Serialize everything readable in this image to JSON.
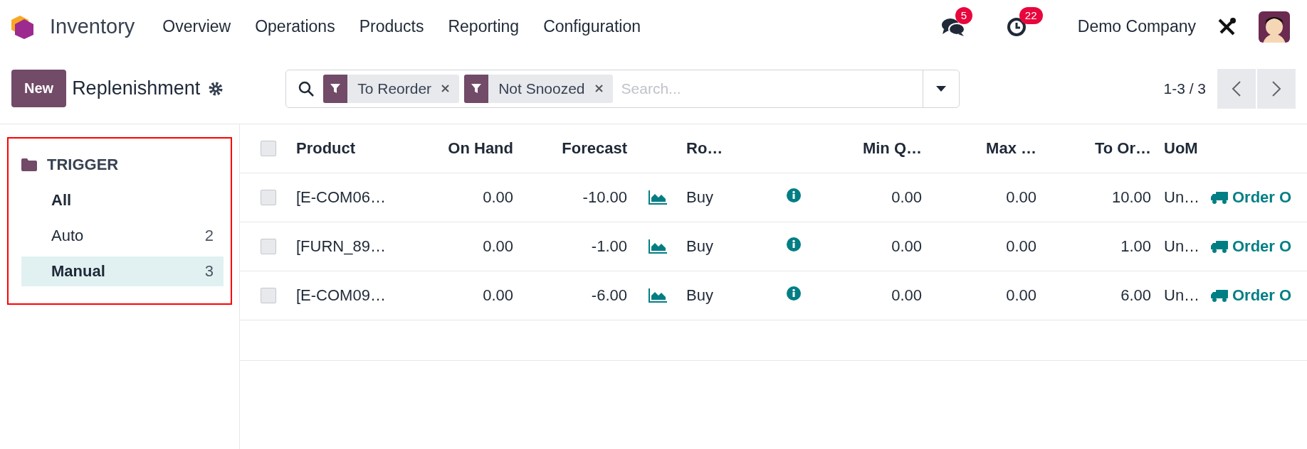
{
  "navbar": {
    "app_name": "Inventory",
    "menu": [
      "Overview",
      "Operations",
      "Products",
      "Reporting",
      "Configuration"
    ],
    "messages_badge": "5",
    "activities_badge": "22",
    "company": "Demo Company"
  },
  "control_panel": {
    "new_button": "New",
    "title": "Replenishment",
    "filters": [
      {
        "label": "To Reorder"
      },
      {
        "label": "Not Snoozed"
      }
    ],
    "search": {
      "placeholder": "Search..."
    },
    "pager": "1-3 / 3"
  },
  "sidebar": {
    "highlighted": true,
    "heading": "TRIGGER",
    "items": [
      {
        "label": "All",
        "selected": false
      },
      {
        "label": "Auto",
        "count": "2",
        "selected": false
      },
      {
        "label": "Manual",
        "count": "3",
        "selected": true
      }
    ]
  },
  "table": {
    "select_all_checked": false,
    "columns": [
      "Product",
      "On Hand",
      "Forecast",
      "Ro…",
      "Min Q…",
      "Max …",
      "To Or…",
      "UoM"
    ],
    "rows": [
      {
        "checked": false,
        "product": "[E-COM06…",
        "on_hand": "0.00",
        "forecast": "-10.00",
        "route": "Buy",
        "min": "0.00",
        "max": "0.00",
        "to_order": "10.00",
        "uom": "Un…",
        "action": "Order O"
      },
      {
        "checked": false,
        "product": "[FURN_89…",
        "on_hand": "0.00",
        "forecast": "-1.00",
        "route": "Buy",
        "min": "0.00",
        "max": "0.00",
        "to_order": "1.00",
        "uom": "Un…",
        "action": "Order O"
      },
      {
        "checked": false,
        "product": "[E-COM09…",
        "on_hand": "0.00",
        "forecast": "-6.00",
        "route": "Buy",
        "min": "0.00",
        "max": "0.00",
        "to_order": "6.00",
        "uom": "Un…",
        "action": "Order O"
      }
    ]
  }
}
